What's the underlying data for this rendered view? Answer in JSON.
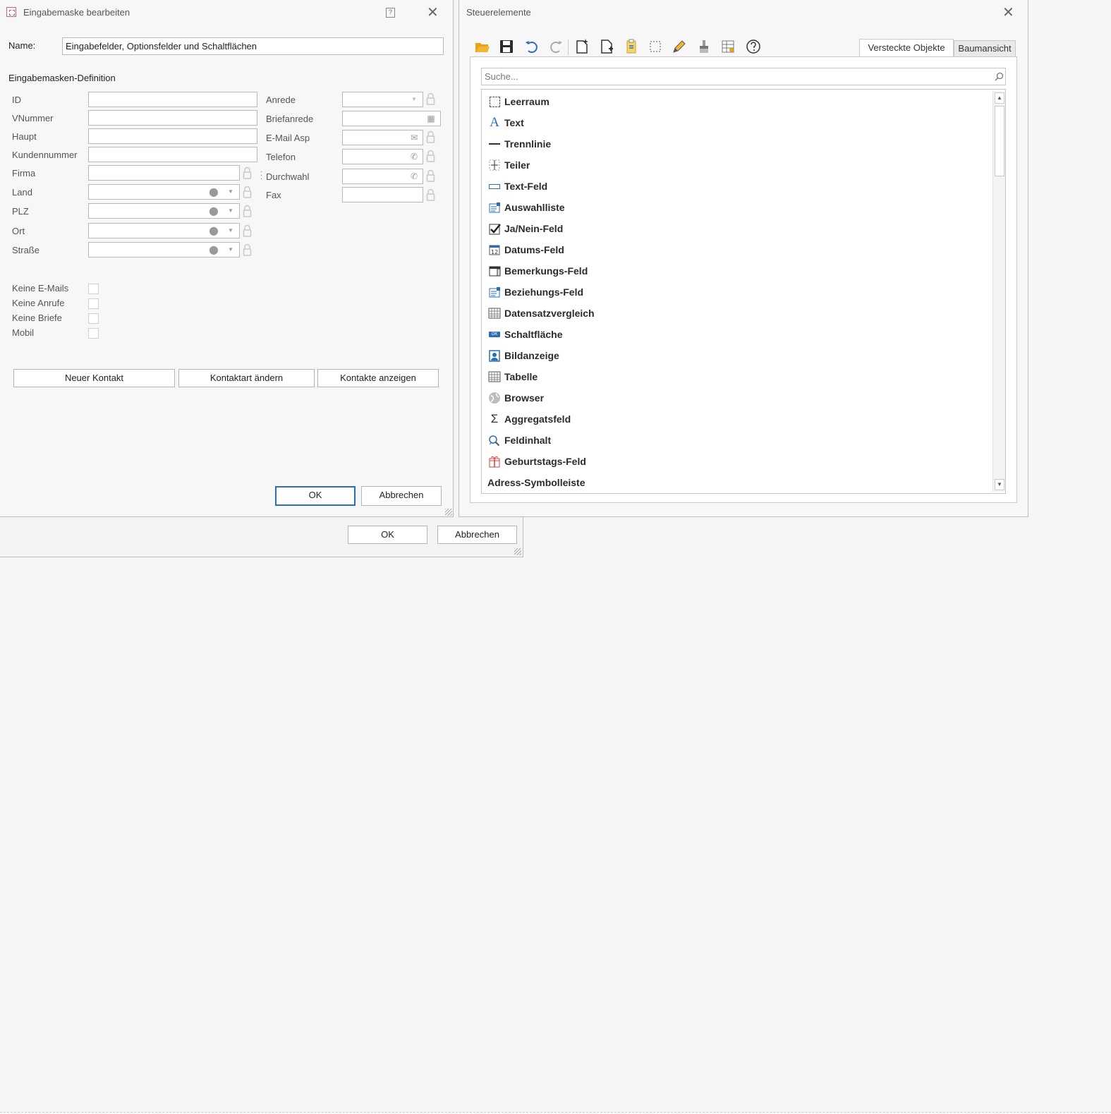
{
  "dialog": {
    "title": "Eingabemaske bearbeiten",
    "name_label": "Name:",
    "name_value": "Eingabefelder, Optionsfelder und Schaltflächen",
    "section_title": "Eingabemasken-Definition",
    "left_fields": [
      "ID",
      "VNummer",
      "Haupt",
      "Kundennummer",
      "Firma",
      "Land",
      "PLZ",
      "Ort",
      "Straße"
    ],
    "right_fields": [
      "Anrede",
      "Briefanrede",
      "E-Mail Asp",
      "Telefon",
      "Durchwahl",
      "Fax"
    ],
    "checkboxes": [
      "Keine E-Mails",
      "Keine Anrufe",
      "Keine Briefe",
      "Mobil"
    ],
    "buttons": {
      "new_contact": "Neuer Kontakt",
      "change_type": "Kontaktart ändern",
      "show_contacts": "Kontakte anzeigen",
      "ok": "OK",
      "cancel": "Abbrechen"
    }
  },
  "back_dialog": {
    "ok": "OK",
    "cancel": "Abbrechen"
  },
  "controls": {
    "title": "Steuerelemente",
    "tabs": [
      "Versteckte Objekte",
      "Baumansicht"
    ],
    "search_placeholder": "Suche...",
    "items": [
      {
        "label": "Leerraum",
        "icon": "blank-space-icon"
      },
      {
        "label": "Text",
        "icon": "text-icon"
      },
      {
        "label": "Trennlinie",
        "icon": "separator-icon"
      },
      {
        "label": "Teiler",
        "icon": "splitter-icon"
      },
      {
        "label": "Text-Feld",
        "icon": "textfield-icon"
      },
      {
        "label": "Auswahlliste",
        "icon": "picklist-icon"
      },
      {
        "label": "Ja/Nein-Feld",
        "icon": "checkbox-icon"
      },
      {
        "label": "Datums-Feld",
        "icon": "calendar-icon"
      },
      {
        "label": "Bemerkungs-Feld",
        "icon": "memo-icon"
      },
      {
        "label": "Beziehungs-Feld",
        "icon": "relation-icon"
      },
      {
        "label": "Datensatzvergleich",
        "icon": "grid-icon"
      },
      {
        "label": "Schaltfläche",
        "icon": "button-icon"
      },
      {
        "label": "Bildanzeige",
        "icon": "image-icon"
      },
      {
        "label": "Tabelle",
        "icon": "table-icon"
      },
      {
        "label": "Browser",
        "icon": "globe-icon"
      },
      {
        "label": "Aggregatsfeld",
        "icon": "sigma-icon"
      },
      {
        "label": "Feldinhalt",
        "icon": "field-content-icon"
      },
      {
        "label": "Geburtstags-Feld",
        "icon": "gift-icon"
      },
      {
        "label": "Adress-Symbolleiste",
        "icon": ""
      }
    ]
  },
  "colors": {
    "accent": "#2a6ebb",
    "folder": "#e8a317"
  }
}
